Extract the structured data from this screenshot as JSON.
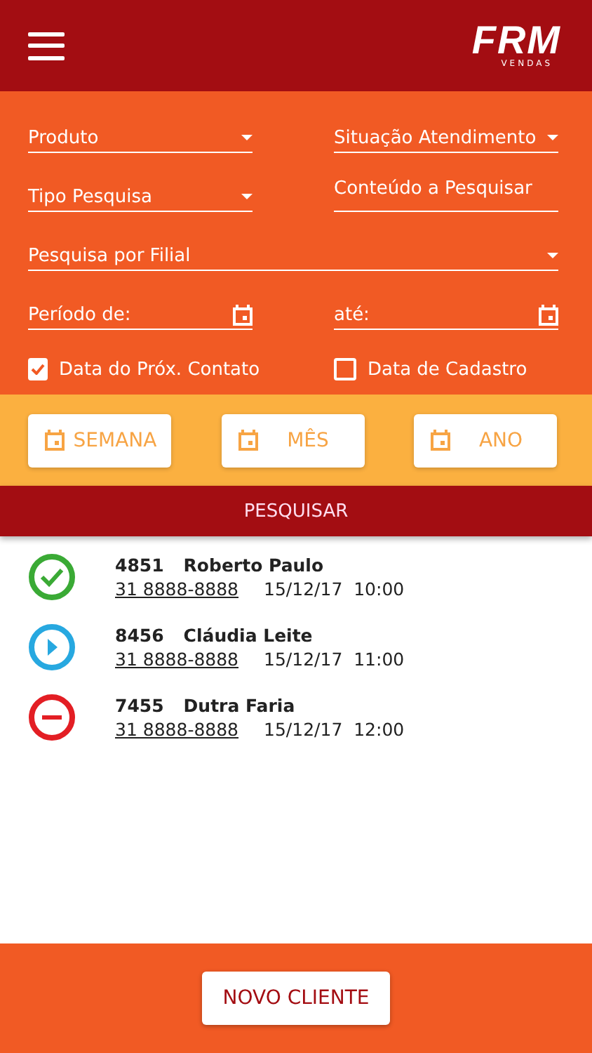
{
  "header": {
    "logo": "FRM",
    "logo_sub": "VENDAS"
  },
  "filters": [
    {
      "kind": "dropdown",
      "label": "Produto",
      "wide": false
    },
    {
      "kind": "dropdown",
      "label": "Situação Atendimento",
      "wide": false
    },
    {
      "kind": "dropdown",
      "label": "Tipo Pesquisa",
      "wide": false
    },
    {
      "kind": "text",
      "placeholder": "Conteúdo a Pesquisar",
      "wide": false
    },
    {
      "kind": "dropdown",
      "label": "Pesquisa por Filial",
      "wide": true
    },
    {
      "kind": "date",
      "label": "Período de:",
      "wide": false
    },
    {
      "kind": "date",
      "label": "até:",
      "wide": false
    }
  ],
  "checkboxes": [
    {
      "label": "Data do Próx. Contato",
      "checked": true
    },
    {
      "label": "Data de Cadastro",
      "checked": false
    }
  ],
  "periods": [
    {
      "label": "SEMANA"
    },
    {
      "label": "MÊS"
    },
    {
      "label": "ANO"
    }
  ],
  "search_button": "PESQUISAR",
  "contacts": [
    {
      "kind": "done",
      "code": "4851",
      "name": "Roberto Paulo",
      "phone": "31 8888-8888",
      "date": "15/12/17",
      "time": "10:00"
    },
    {
      "kind": "playing",
      "code": "8456",
      "name": "Cláudia Leite",
      "phone": "31 8888-8888",
      "date": "15/12/17",
      "time": "11:00"
    },
    {
      "kind": "blocked",
      "code": "7455",
      "name": "Dutra Faria",
      "phone": "31 8888-8888",
      "date": "15/12/17",
      "time": "12:00"
    }
  ],
  "new_client_button": "NOVO CLIENTE"
}
